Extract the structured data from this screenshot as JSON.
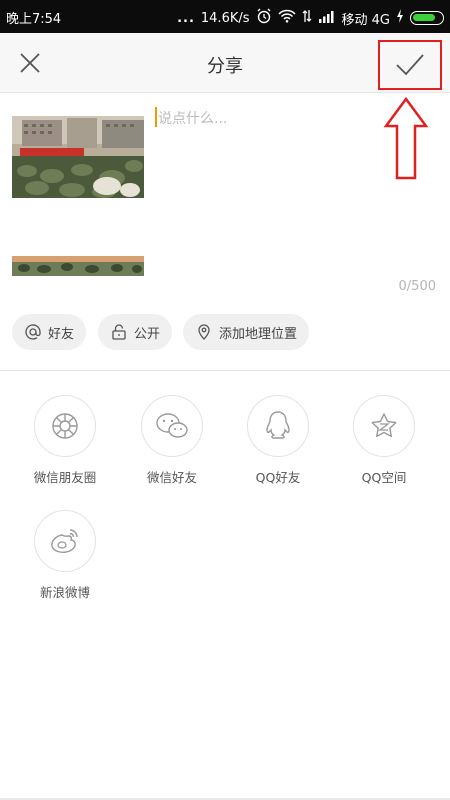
{
  "status_bar": {
    "time": "晚上7:54",
    "dots": "...",
    "speed": "14.6K/s",
    "carrier": "移动 4G",
    "icons": [
      "alarm-icon",
      "wifi-icon",
      "data-arrows-icon",
      "signal-icon",
      "charging-icon",
      "battery-icon"
    ]
  },
  "header": {
    "title": "分享",
    "close_icon": "close-icon",
    "confirm_icon": "checkmark-icon"
  },
  "compose": {
    "placeholder": "说点什么...",
    "counter": "0/500"
  },
  "chips": [
    {
      "label": "好友",
      "icon": "at-icon"
    },
    {
      "label": "公开",
      "icon": "lock-icon"
    },
    {
      "label": "添加地理位置",
      "icon": "location-pin-icon"
    }
  ],
  "targets": [
    {
      "label": "微信朋友圈",
      "icon": "wechat-moments-icon"
    },
    {
      "label": "微信好友",
      "icon": "wechat-icon"
    },
    {
      "label": "QQ好友",
      "icon": "qq-icon"
    },
    {
      "label": "QQ空间",
      "icon": "qzone-icon"
    },
    {
      "label": "新浪微博",
      "icon": "weibo-icon"
    }
  ],
  "colors": {
    "status_bar_bg": "#0c0c0c",
    "header_bg": "#f7f7f7",
    "annotation_red": "#e02020",
    "cursor": "#f29a00",
    "battery": "#3ad13a"
  }
}
